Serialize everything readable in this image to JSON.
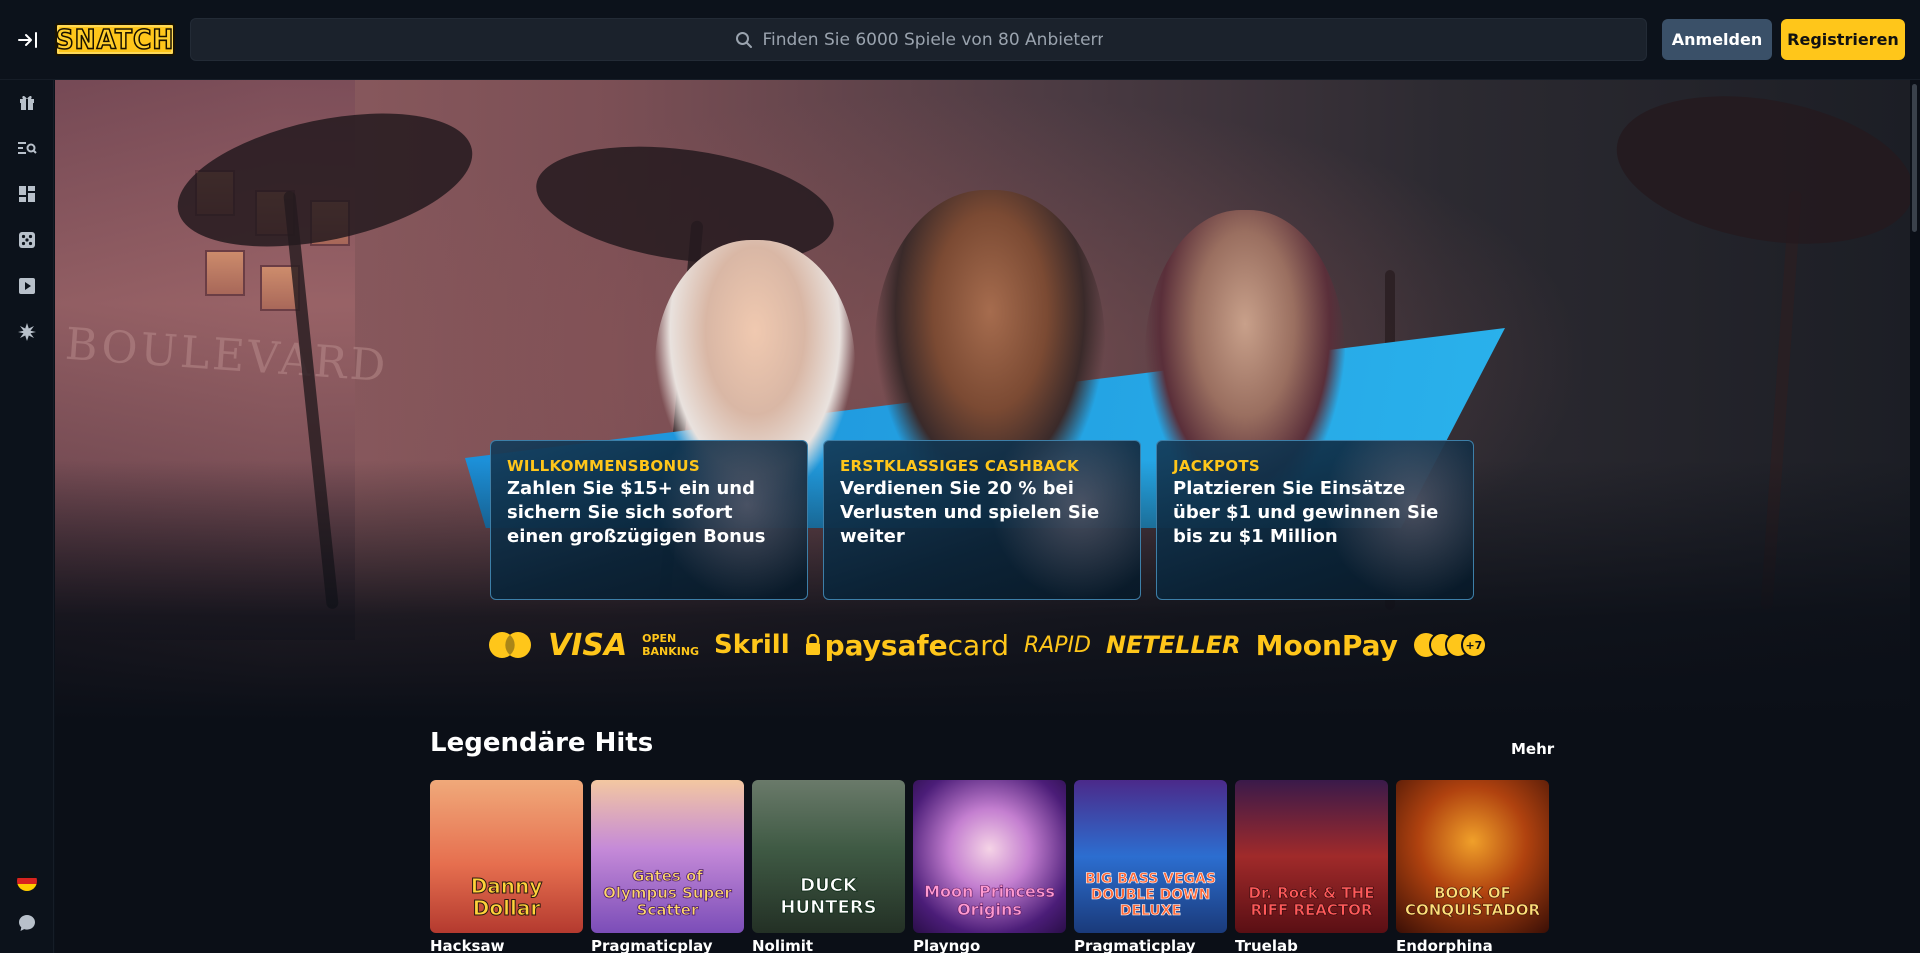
{
  "header": {
    "logo_text": "SNATCH",
    "search_placeholder": "Finden Sie 6000 Spiele von 80 Anbietern",
    "login_label": "Anmelden",
    "register_label": "Registrieren"
  },
  "sidebar": {
    "icons": [
      "gift-icon",
      "search-list-icon",
      "dashboard-icon",
      "dice-icon",
      "play-icon",
      "burst-icon"
    ],
    "bottom_icons": [
      "german-flag-icon",
      "chat-icon"
    ]
  },
  "hero": {
    "background_text": "BOULEVARD",
    "promos": [
      {
        "tag": "WILLKOMMENSBONUS",
        "desc": "Zahlen Sie $15+ ein und sichern Sie sich sofort einen großzügigen Bonus"
      },
      {
        "tag": "ERSTKLASSIGES CASHBACK",
        "desc": "Verdienen Sie 20 % bei Verlusten und spielen Sie weiter"
      },
      {
        "tag": "JACKPOTS",
        "desc": "Platzieren Sie Einsätze über $1 und gewinnen Sie bis zu $1 Million"
      }
    ]
  },
  "payments": {
    "visa": "VISA",
    "open_banking_line1": "OPEN",
    "open_banking_line2": "BANKING",
    "skrill": "Skrill",
    "paysafecard_main": "paysafe",
    "paysafecard_suffix": "card",
    "rapid": "RAPID",
    "neteller": "NETELLER",
    "moonpay": "MoonPay",
    "crypto_more": "+7"
  },
  "section": {
    "title": "Legendäre Hits",
    "more_label": "Mehr",
    "games": [
      {
        "name": "Danny Dollar",
        "provider": "Hacksaw"
      },
      {
        "name": "Gates of Olympus Super Scatter",
        "provider": "Pragmaticplay"
      },
      {
        "name": "DUCK HUNTERS",
        "provider": "Nolimit"
      },
      {
        "name": "Moon Princess Origins",
        "provider": "Playngo"
      },
      {
        "name": "BIG BASS VEGAS DOUBLE DOWN DELUXE",
        "provider": "Pragmaticplay"
      },
      {
        "name": "Dr. Rock & THE RIFF REACTOR",
        "provider": "Truelab"
      },
      {
        "name": "BOOK OF CONQUISTADOR",
        "provider": "Endorphina"
      }
    ]
  },
  "colors": {
    "accent": "#ffc61a",
    "login_bg": "#3a5068",
    "bg": "#0b111a"
  }
}
